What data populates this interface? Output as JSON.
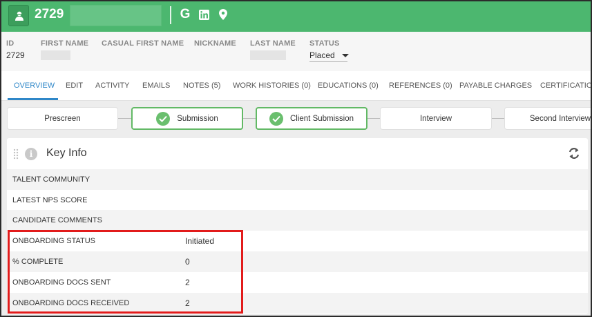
{
  "header": {
    "record_id": "2729",
    "icons": [
      "person-icon",
      "google-icon",
      "linkedin-icon",
      "location-icon"
    ],
    "accent_color": "#4cb76f"
  },
  "info": {
    "id_label": "ID",
    "id_value": "2729",
    "first_name_label": "FIRST NAME",
    "casual_first_name_label": "CASUAL FIRST NAME",
    "nickname_label": "NICKNAME",
    "last_name_label": "LAST NAME",
    "status_label": "STATUS",
    "status_value": "Placed"
  },
  "tabs": [
    {
      "label": "OVERVIEW",
      "active": true
    },
    {
      "label": "EDIT"
    },
    {
      "label": "ACTIVITY"
    },
    {
      "label": "EMAILS"
    },
    {
      "label": "NOTES (5)"
    },
    {
      "label": "WORK HISTORIES (0)"
    },
    {
      "label": "EDUCATIONS (0)"
    },
    {
      "label": "REFERENCES (0)"
    },
    {
      "label": "PAYABLE CHARGES"
    },
    {
      "label": "CERTIFICATIONS"
    }
  ],
  "pipeline": [
    {
      "label": "Prescreen",
      "done": false
    },
    {
      "label": "Submission",
      "done": true
    },
    {
      "label": "Client Submission",
      "done": true
    },
    {
      "label": "Interview",
      "done": false
    },
    {
      "label": "Second Interview",
      "done": false
    }
  ],
  "key_info": {
    "title": "Key Info",
    "rows": [
      {
        "label": "TALENT COMMUNITY",
        "value": ""
      },
      {
        "label": "LATEST NPS SCORE",
        "value": ""
      },
      {
        "label": "CANDIDATE COMMENTS",
        "value": ""
      },
      {
        "label": "ONBOARDING STATUS",
        "value": "Initiated"
      },
      {
        "label": "% COMPLETE",
        "value": "0"
      },
      {
        "label": "ONBOARDING DOCS SENT",
        "value": "2"
      },
      {
        "label": "ONBOARDING DOCS RECEIVED",
        "value": "2"
      }
    ]
  }
}
